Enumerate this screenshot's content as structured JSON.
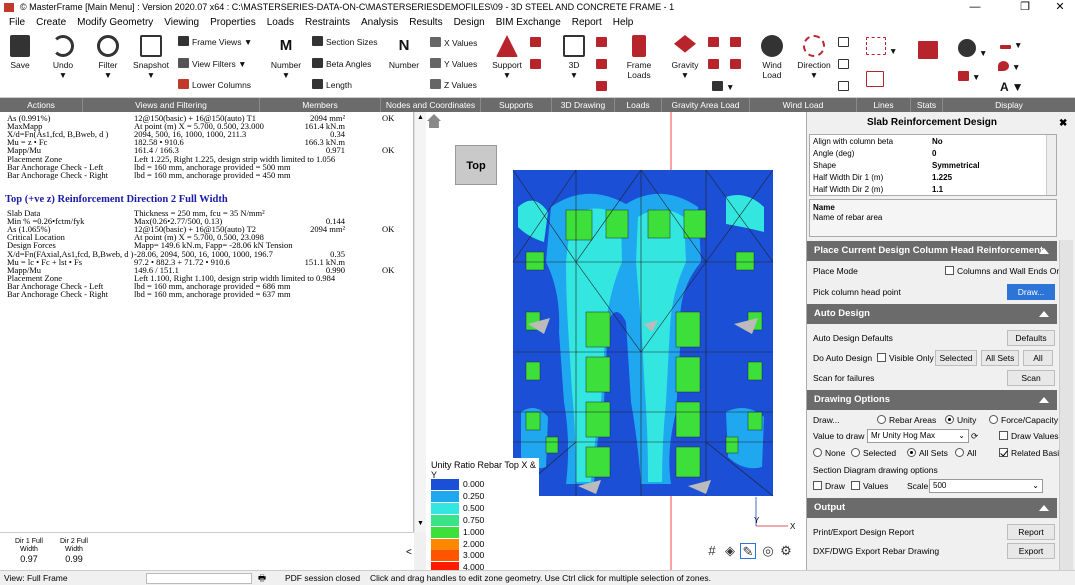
{
  "window": {
    "title": "© MasterFrame [Main Menu] : Version 2020.07 x64 : C:\\MASTERSERIES-DATA-ON-C\\MASTERSERIESDEMOFILES\\09 - 3D STEEL AND CONCRETE FRAME - 1",
    "minimize": "—",
    "restore": "❐",
    "close": "✕"
  },
  "menu": [
    "File",
    "Create",
    "Modify Geometry",
    "Viewing",
    "Properties",
    "Loads",
    "Restraints",
    "Analysis",
    "Results",
    "Design",
    "BIM Exchange",
    "Report",
    "Help"
  ],
  "ribbon": {
    "save": "Save",
    "undo": "Undo",
    "filter": "Filter",
    "snapshot": "Snapshot",
    "frame_views": "Frame Views",
    "view_filters": "View Filters",
    "lower_columns": "Lower Columns",
    "number_members": "Number",
    "section_sizes": "Section Sizes",
    "beta_angles": "Beta Angles",
    "length": "Length",
    "number_nodes": "Number",
    "x_values": "X Values",
    "y_values": "Y Values",
    "z_values": "Z Values",
    "support": "Support",
    "three_d": "3D",
    "frame_loads": "Frame Loads",
    "gravity": "Gravity",
    "wind_load": "Wind Load",
    "direction": "Direction",
    "arrow": "▼"
  },
  "groups": [
    "Actions",
    "Views and Filtering",
    "Members",
    "Nodes and Coordinates",
    "Supports",
    "3D Drawing",
    "Loads",
    "Gravity Area Load",
    "Wind Load",
    "Lines",
    "Stats",
    "Display"
  ],
  "report": {
    "lines1": [
      {
        "l": "As (0.991%)",
        "v": "12@150(basic) + 16@150(auto) T1",
        "n": "2094 mm²",
        "ok": "OK"
      },
      {
        "l": "MaxMapp",
        "v": "At point (m) X = 5.700, 0.500, 23.000",
        "n": "161.4 kN.m",
        "ok": ""
      },
      {
        "l": "X/d=Fn(As1,fcd, B,Bweb, d )",
        "v": "2094, 500, 16, 1000, 1000, 211.3",
        "n": "0.34",
        "ok": ""
      },
      {
        "l": "Mu = z • Fc",
        "v": "182.58 • 910.6",
        "n": "166.3 kN.m",
        "ok": ""
      },
      {
        "l": "Mapp/Mu",
        "v": "161.4 / 166.3",
        "n": "0.971",
        "ok": "OK"
      },
      {
        "l": "Placement Zone",
        "v": "Left 1.225, Right 1.225, design strip width limited to 1.056",
        "n": "",
        "ok": ""
      },
      {
        "l": "Bar Anchorage Check - Left",
        "v": "lbd = 160 mm, anchorage provided = 500 mm",
        "n": "",
        "ok": ""
      },
      {
        "l": "Bar Anchorage Check - Right",
        "v": "lbd = 160 mm, anchorage provided = 450 mm",
        "n": "",
        "ok": ""
      }
    ],
    "heading": "Top (+ve z) Reinforcement Direction 2 Full Width",
    "lines2": [
      {
        "l": "Slab Data",
        "v": "Thickness = 250 mm, fcu = 35 N/mm²",
        "n": "",
        "ok": ""
      },
      {
        "l": "Min % =0.26•fctm/fyk",
        "v": "Max(0.26•2.77/500, 0.13)",
        "n": "0.144",
        "ok": ""
      },
      {
        "l": "As (1.065%)",
        "v": "12@150(basic) + 16@150(auto) T2",
        "n": "2094 mm²",
        "ok": "OK"
      },
      {
        "l": "Critical Location",
        "v": "At point (m) X = 5.700, 0.500, 23.098",
        "n": "",
        "ok": ""
      },
      {
        "l": "Design Forces",
        "v": "Mapp= 149.6 kN.m, Fapp= -28.06 kN Tension",
        "n": "",
        "ok": ""
      },
      {
        "l": "X/d=Fn(FAxial,As1,fcd, B,Bweb, d )",
        "v": "-28.06, 2094, 500, 16, 1000, 1000, 196.7",
        "n": "0.35",
        "ok": ""
      },
      {
        "l": "Mu = lc • Fc + lst • Fs",
        "v": "97.2 • 882.3 + 71.72 • 910.6",
        "n": "151.1 kN.m",
        "ok": ""
      },
      {
        "l": "Mapp/Mu",
        "v": "149.6 / 151.1",
        "n": "0.990",
        "ok": "OK"
      },
      {
        "l": "Placement Zone",
        "v": "Left 1.100, Right 1.100, design strip width limited to 0.984",
        "n": "",
        "ok": ""
      },
      {
        "l": "Bar Anchorage Check - Left",
        "v": "lbd = 160 mm, anchorage provided = 686 mm",
        "n": "",
        "ok": ""
      },
      {
        "l": "Bar Anchorage Check - Right",
        "v": "lbd = 160 mm, anchorage provided = 637 mm",
        "n": "",
        "ok": ""
      }
    ]
  },
  "mini_table": {
    "col1_h1": "Dir 1  Full",
    "col1_h2": "Width",
    "col1_v": "0.97",
    "col2_h1": "Dir 2  Full",
    "col2_h2": "Width",
    "col2_v": "0.99",
    "arrow": "<"
  },
  "view": {
    "top_button": "Top",
    "axis_x": "X",
    "axis_y": "Y"
  },
  "legend": {
    "title": "Unity Ratio Rebar Top X & Y",
    "items": [
      {
        "label": "0.000",
        "color": "#1b4fd6"
      },
      {
        "label": "0.250",
        "color": "#1fa8f0"
      },
      {
        "label": "0.500",
        "color": "#33e6e0"
      },
      {
        "label": "0.750",
        "color": "#3ae38a"
      },
      {
        "label": "1.000",
        "color": "#3de03a"
      },
      {
        "label": "2.000",
        "color": "#ff8800"
      },
      {
        "label": "3.000",
        "color": "#ff5500"
      },
      {
        "label": "4.000",
        "color": "#ff1a00"
      }
    ]
  },
  "panel": {
    "title": "Slab Reinforcement Design",
    "close": "✖",
    "props": [
      {
        "k": "Align with column beta",
        "v": "No"
      },
      {
        "k": "Angle (deg)",
        "v": "0"
      },
      {
        "k": "Shape",
        "v": "Symmetrical"
      },
      {
        "k": "Half Width Dir 1 (m)",
        "v": "1.225"
      },
      {
        "k": "Half Width Dir 2 (m)",
        "v": "1.1"
      }
    ],
    "desc_title": "Name",
    "desc_text": "Name of rebar area",
    "sec_place": "Place Current Design Column Head Reinforcement",
    "place_mode": "Place Mode",
    "columns_wall_ends": "Columns and Wall Ends Only",
    "pick_head": "Pick column head point",
    "draw_btn": "Draw...",
    "sec_auto": "Auto Design",
    "auto_defaults": "Auto Design Defaults",
    "defaults_btn": "Defaults",
    "do_auto": "Do Auto Design",
    "visible_only": "Visible Only",
    "selected_btn": "Selected",
    "all_sets_btn": "All Sets",
    "all_btn": "All",
    "scan_failures": "Scan for failures",
    "scan_btn": "Scan",
    "sec_draw": "Drawing Options",
    "draw_label": "Draw...",
    "rebar_areas": "Rebar Areas",
    "unity": "Unity",
    "force_capacity": "Force/Capacity",
    "value_to_draw": "Value to draw",
    "value_select": "Mr Unity Hog Max",
    "draw_values": "Draw Values",
    "none": "None",
    "selected": "Selected",
    "all_sets": "All Sets",
    "all": "All",
    "related_basic": "Related Basic",
    "section_diag": "Section Diagram drawing options",
    "draw": "Draw",
    "values": "Values",
    "scale": "Scale",
    "scale_value": "500",
    "sec_output": "Output",
    "print_report": "Print/Export Design Report",
    "report_btn": "Report",
    "dxf_export": "DXF/DWG Export Rebar Drawing",
    "export_btn": "Export"
  },
  "status": {
    "view": "View: Full Frame",
    "pdf": "PDF session closed",
    "hint": "Click and drag handles to edit zone geometry. Use Ctrl click for multiple selection of zones."
  }
}
